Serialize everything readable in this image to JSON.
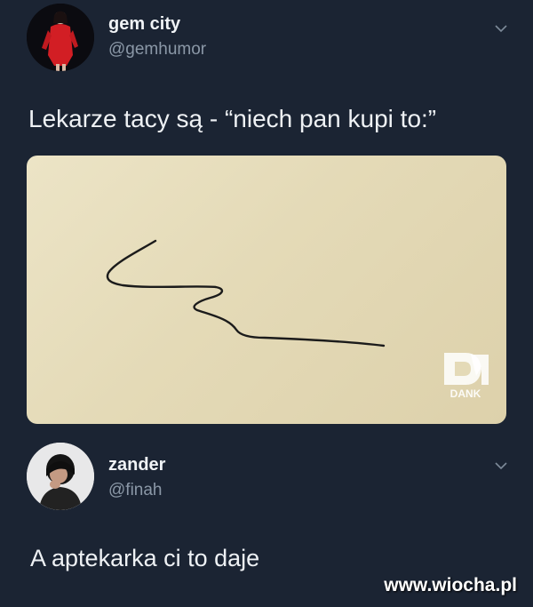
{
  "tweet1": {
    "name": "gem city",
    "handle": "@gemhumor",
    "text": "Lekarze tacy są - “niech pan kupi to:”",
    "menu_icon": "chevron-down-icon",
    "image": {
      "description_icon": "signature-scribble",
      "watermark_icon": "dank-memeology-logo",
      "watermark_text": "DANK"
    }
  },
  "tweet2": {
    "name": "zander",
    "handle": "@finah",
    "text": "A aptekarka ci to daje",
    "menu_icon": "chevron-down-icon"
  },
  "site_watermark": "www.wiocha.pl",
  "colors": {
    "background": "#1b2433",
    "handle": "#8b98a7",
    "card": "#e4dab7"
  }
}
